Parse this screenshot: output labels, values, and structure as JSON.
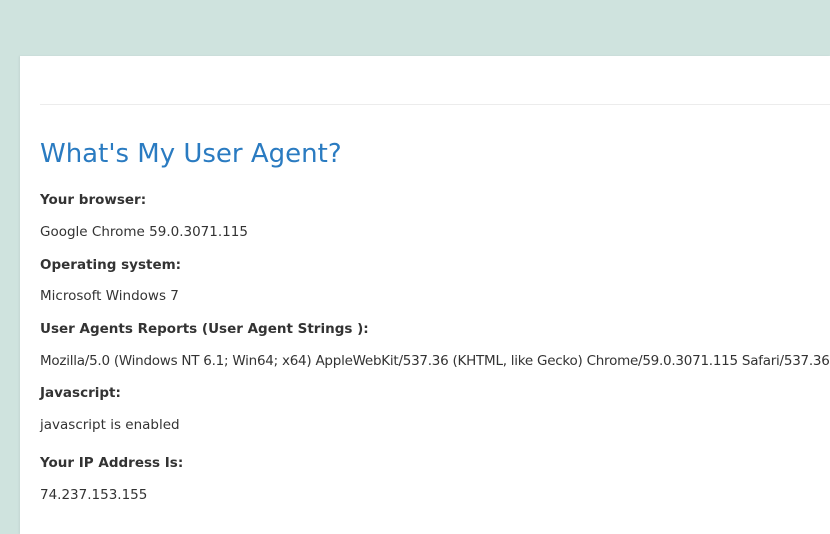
{
  "page": {
    "title": "What's My User Agent?"
  },
  "sections": {
    "browser": {
      "label": "Your browser:",
      "value": "Google Chrome 59.0.3071.115"
    },
    "os": {
      "label": "Operating system:",
      "value": "Microsoft Windows 7"
    },
    "ua": {
      "label": "User Agents Reports (User Agent Strings ):",
      "value": "Mozilla/5.0 (Windows NT 6.1; Win64; x64) AppleWebKit/537.36 (KHTML, like Gecko) Chrome/59.0.3071.115 Safari/537.36"
    },
    "javascript": {
      "label": "Javascript:",
      "value": "javascript is enabled"
    },
    "ip": {
      "label": "Your IP Address Is:",
      "value": "74.237.153.155"
    }
  },
  "colors": {
    "background": "#cfe3de",
    "card": "#ffffff",
    "title": "#2a7bc1",
    "text": "#333333"
  }
}
